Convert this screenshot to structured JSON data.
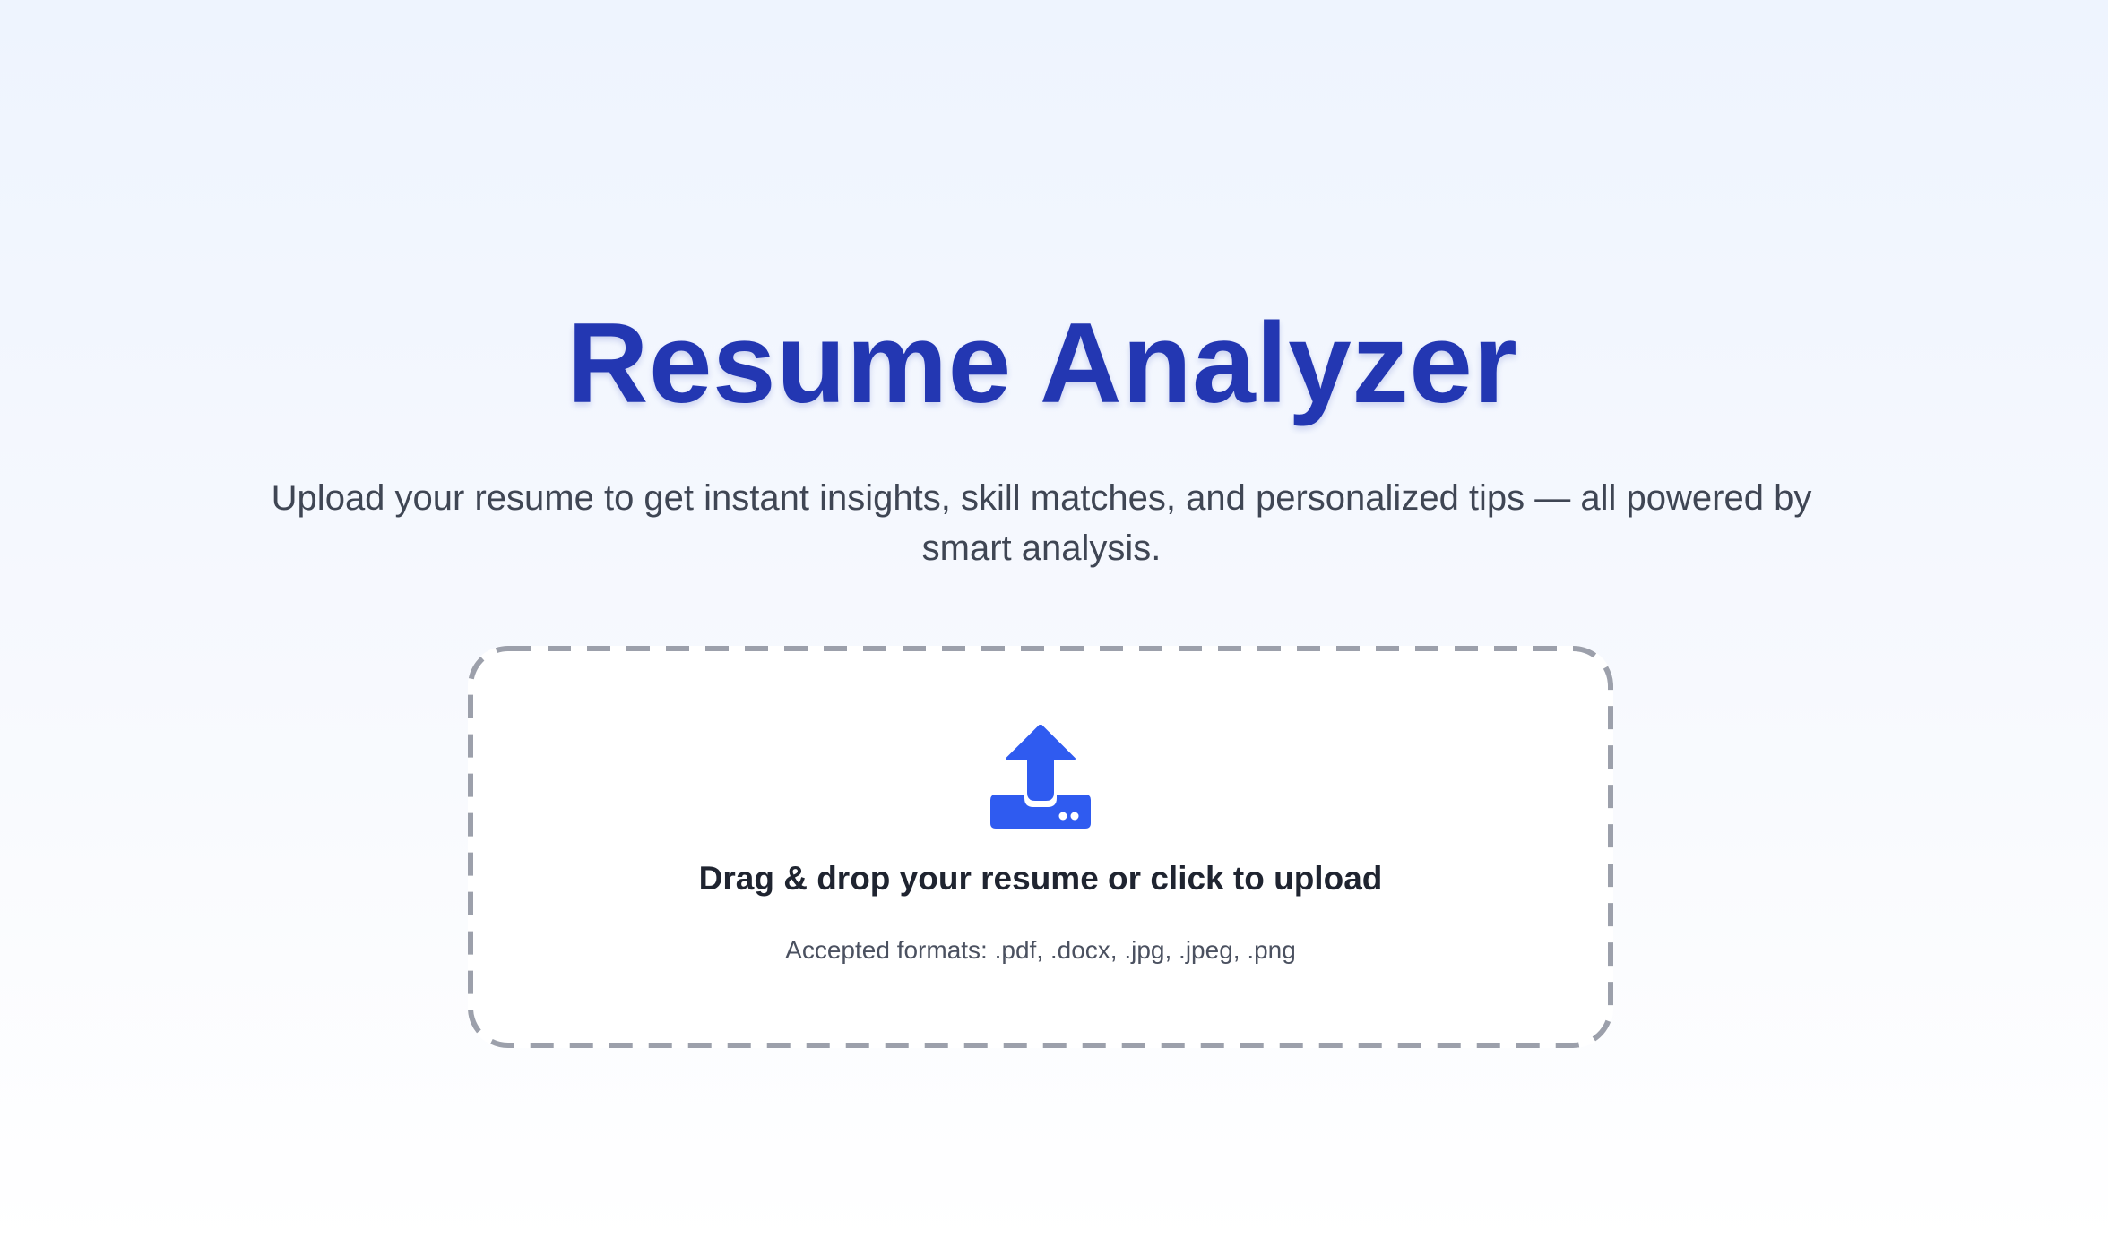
{
  "page": {
    "title": "Resume Analyzer",
    "subtitle": "Upload your resume to get instant insights, skill matches, and personalized tips — all powered by smart analysis."
  },
  "upload": {
    "icon": "upload-tray-icon",
    "prompt": "Drag & drop your resume or click to upload",
    "formats_text": "Accepted formats: .pdf, .docx, .jpg, .jpeg, .png",
    "accept": ".pdf,.docx,.jpg,.jpeg,.png"
  },
  "colors": {
    "title": "#2337b2",
    "accent": "#2f5bf0",
    "dash_border": "#9ca0ab",
    "subtitle_text": "#3f4654",
    "background_top": "#eef4fe"
  }
}
